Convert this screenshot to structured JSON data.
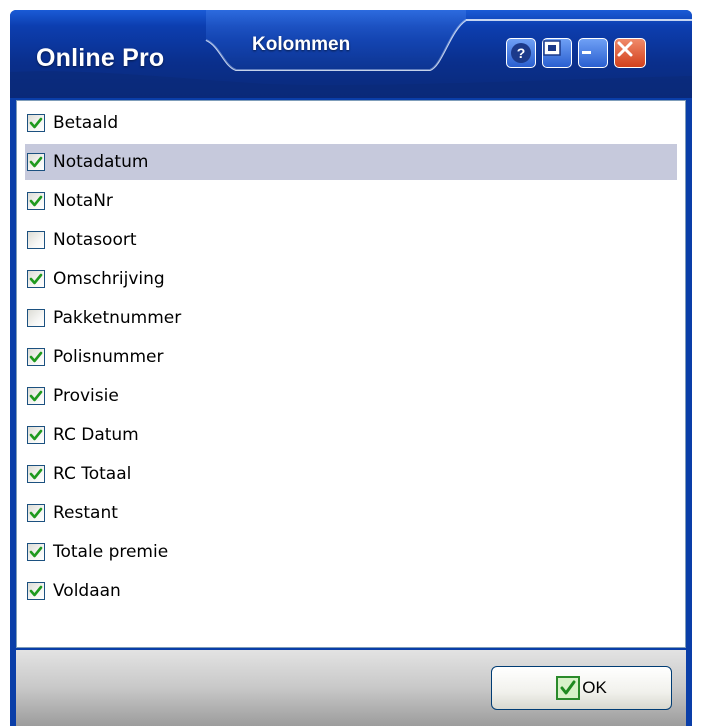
{
  "window": {
    "app_title": "Online Pro",
    "tab_title": "Kolommen",
    "controls": {
      "help_icon": "help-icon",
      "screenshot_icon": "screenshot-icon",
      "minimize_icon": "minimize-icon",
      "close_icon": "close-icon"
    }
  },
  "columns": [
    {
      "label": "Betaald",
      "checked": true,
      "selected": false
    },
    {
      "label": "Notadatum",
      "checked": true,
      "selected": true
    },
    {
      "label": "NotaNr",
      "checked": true,
      "selected": false
    },
    {
      "label": "Notasoort",
      "checked": false,
      "selected": false
    },
    {
      "label": "Omschrijving",
      "checked": true,
      "selected": false
    },
    {
      "label": "Pakketnummer",
      "checked": false,
      "selected": false
    },
    {
      "label": "Polisnummer",
      "checked": true,
      "selected": false
    },
    {
      "label": "Provisie",
      "checked": true,
      "selected": false
    },
    {
      "label": "RC Datum",
      "checked": true,
      "selected": false
    },
    {
      "label": "RC Totaal",
      "checked": true,
      "selected": false
    },
    {
      "label": "Restant",
      "checked": true,
      "selected": false
    },
    {
      "label": "Totale premie",
      "checked": true,
      "selected": false
    },
    {
      "label": "Voldaan",
      "checked": true,
      "selected": false
    }
  ],
  "footer": {
    "ok_label": "OK"
  },
  "colors": {
    "titlebar": "#0a2f8c",
    "selection": "#c6c9dc",
    "check_green": "#1f9a1f",
    "close_red": "#d2401c"
  }
}
